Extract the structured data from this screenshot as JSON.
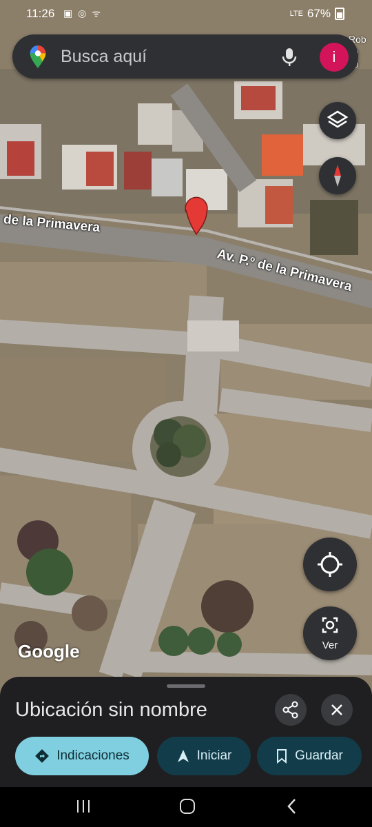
{
  "status_bar": {
    "time": "11:26",
    "icons": "▣ ◎ ᯤ",
    "signal": "LTE",
    "battery": "67%"
  },
  "search": {
    "placeholder": "Busca aquí",
    "avatar_initial": "i"
  },
  "edge_text": "Rob\nvo\nco",
  "map_labels": {
    "road_left": "de la Primavera",
    "road_right": "Av. P.º de la Primavera"
  },
  "watermark": "Google",
  "buttons": {
    "ver_label": "Ver"
  },
  "sheet": {
    "title": "Ubicación sin nombre",
    "chips": [
      {
        "label": "Indicaciones"
      },
      {
        "label": "Iniciar"
      },
      {
        "label": "Guardar"
      }
    ]
  },
  "colors": {
    "pin": "#e53935",
    "primary_chip": "#7fcfe0",
    "secondary_chip": "#123c49",
    "avatar": "#d4145a"
  }
}
